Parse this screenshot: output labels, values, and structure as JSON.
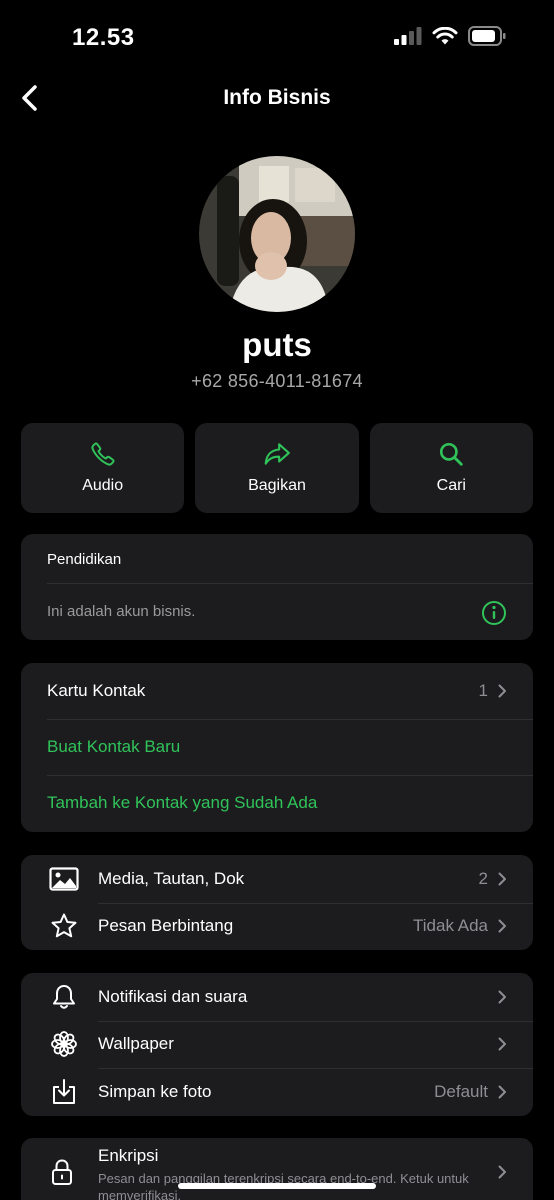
{
  "status_bar": {
    "time": "12.53"
  },
  "nav": {
    "title": "Info Bisnis"
  },
  "profile": {
    "name": "puts",
    "phone": "+62 856-4011-81674"
  },
  "actions": [
    {
      "label": "Audio",
      "icon": "phone-icon"
    },
    {
      "label": "Bagikan",
      "icon": "share-icon"
    },
    {
      "label": "Cari",
      "icon": "search-icon"
    }
  ],
  "business": {
    "category": "Pendidikan",
    "info_text": "Ini adalah akun bisnis."
  },
  "contact_card": {
    "title": "Kartu Kontak",
    "count": "1",
    "create_new": "Buat Kontak Baru",
    "add_existing": "Tambah ke Kontak yang Sudah Ada"
  },
  "media_section": {
    "media": {
      "label": "Media, Tautan, Dok",
      "value": "2"
    },
    "starred": {
      "label": "Pesan Berbintang",
      "value": "Tidak Ada"
    }
  },
  "settings_section": {
    "notifications": {
      "label": "Notifikasi dan suara"
    },
    "wallpaper": {
      "label": "Wallpaper"
    },
    "save_photo": {
      "label": "Simpan ke foto",
      "value": "Default"
    }
  },
  "encryption": {
    "title": "Enkripsi",
    "subtitle": "Pesan dan panggilan terenkripsi secara end-to-end. Ketuk untuk memverifikasi."
  },
  "colors": {
    "accent": "#30c35a",
    "background": "#000000",
    "card": "#1c1c1e",
    "secondary_text": "#8e8e93"
  }
}
